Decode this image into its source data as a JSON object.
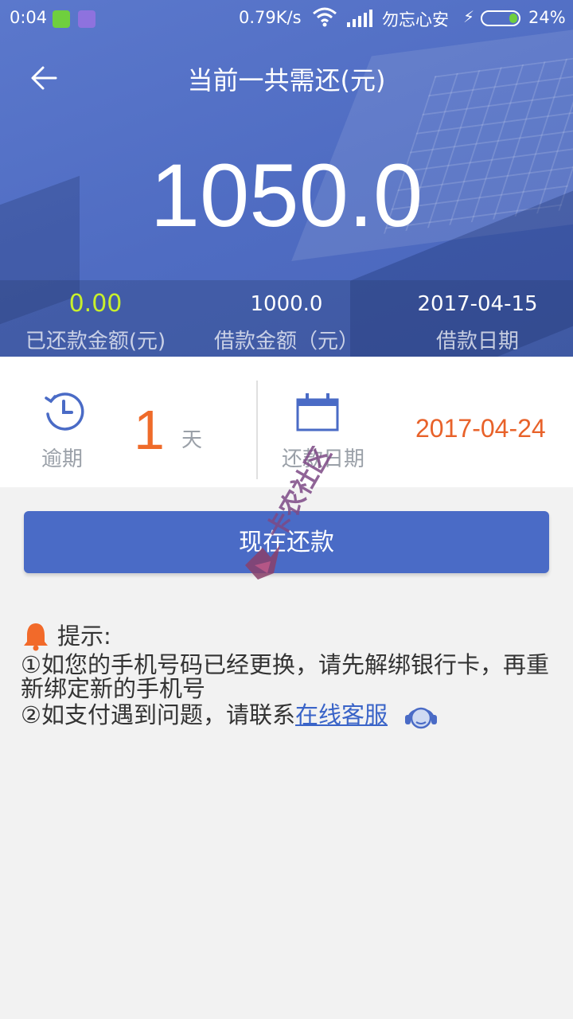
{
  "status_bar": {
    "time": "0:04",
    "speed": "0.79K/s",
    "carrier": "勿忘心安",
    "battery": "24%"
  },
  "header": {
    "title": "当前一共需还(元)",
    "amount": "1050.0",
    "repaid_value": "0.00",
    "repaid_label": "已还款金额(元)",
    "loan_value": "1000.0",
    "loan_label": "借款金额（元）",
    "date_value": "2017-04-15",
    "date_label": "借款日期"
  },
  "overdue": {
    "label": "逾期",
    "days": "1",
    "unit": "天"
  },
  "due": {
    "label": "还款日期",
    "date": "2017-04-24"
  },
  "pay_button": "现在还款",
  "tips": {
    "title": "提示:",
    "line1": "①如您的手机号码已经更换，请先解绑银行卡，再重新绑定新的手机号",
    "line2_prefix": "②如支付遇到问题，请联系",
    "line2_link": "在线客服"
  },
  "watermark": "卡农社区",
  "colors": {
    "header_blue": "#4f6cc2",
    "accent_orange": "#ef6b2a",
    "repaid_green": "#c8f02c",
    "button_blue": "#4a6bc6"
  }
}
